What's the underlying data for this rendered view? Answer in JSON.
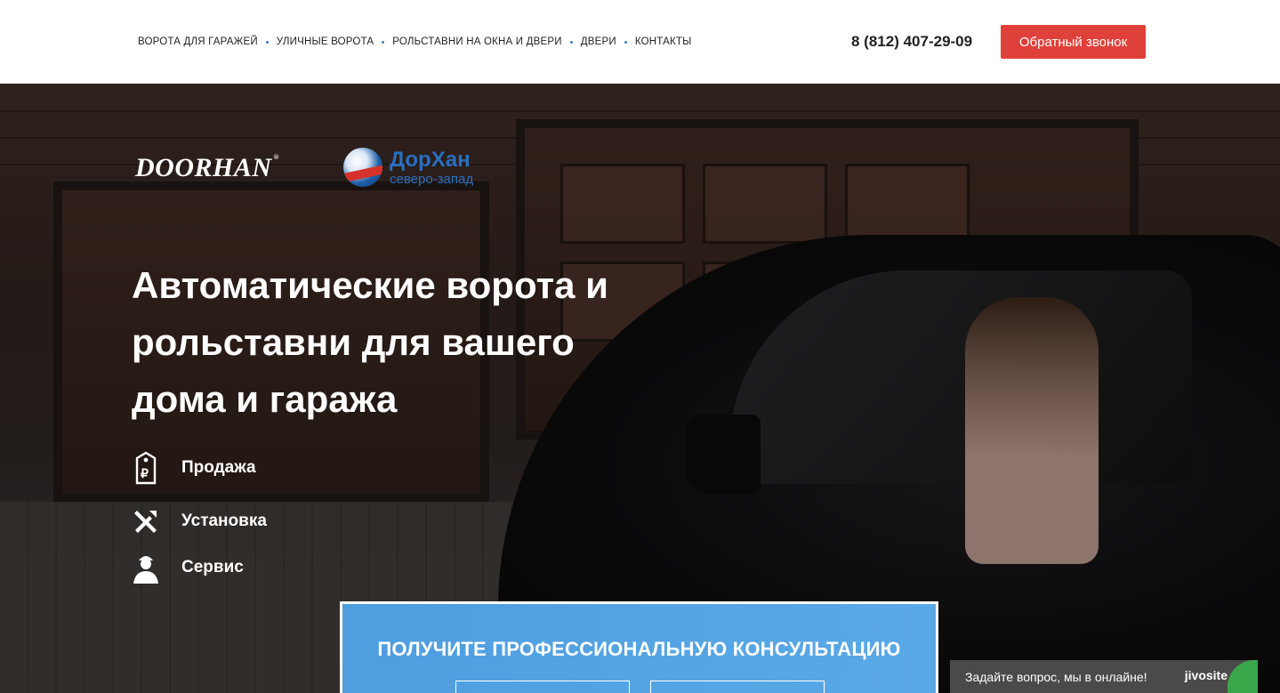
{
  "header": {
    "nav": [
      {
        "label": "ВОРОТА ДЛЯ ГАРАЖЕЙ"
      },
      {
        "label": "УЛИЧНЫЕ ВОРОТА"
      },
      {
        "label": "РОЛЬСТАВНИ НА ОКНА И ДВЕРИ"
      },
      {
        "label": "ДВЕРИ"
      },
      {
        "label": "КОНТАКТЫ"
      }
    ],
    "phone": "8 (812) 407-29-09",
    "callback_label": "Обратный звонок"
  },
  "hero": {
    "logo_doorhan": "DOORHAN",
    "logo_doorhan_mark": "®",
    "logo_dor_name": "ДорХан",
    "logo_dor_sub": "северо-запад",
    "headline_1": "Автоматические ворота и",
    "headline_2": "рольставни для вашего",
    "headline_3": "дома и гаража",
    "features": [
      {
        "label": "Продажа",
        "icon": "price-tag-icon"
      },
      {
        "label": "Установка",
        "icon": "tools-icon"
      },
      {
        "label": "Сервис",
        "icon": "worker-icon"
      }
    ]
  },
  "consult": {
    "title": "ПОЛУЧИТЕ ПРОФЕССИОНАЛЬНУЮ КОНСУЛЬТАЦИЮ"
  },
  "chat": {
    "label": "Задайте вопрос, мы в онлайне!",
    "brand": "jivosite"
  },
  "colors": {
    "accent": "#e0403a",
    "consult_bg": "#4e9ee0",
    "link_blue": "#2a6fc1"
  }
}
